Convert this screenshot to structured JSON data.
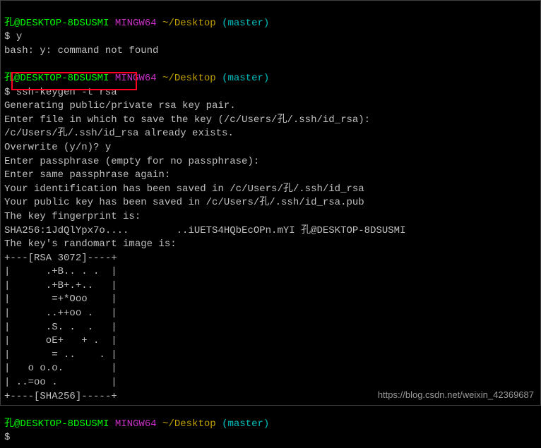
{
  "prompt1": {
    "user": "孔@DESKTOP-8DSUSMI",
    "shell": "MINGW64",
    "path": "~/Desktop",
    "branch": "(master)"
  },
  "line_prompt_dollar": "$",
  "cmd1": "y",
  "err1": "bash: y: command not found",
  "cmd2": "ssh-keygen -t rsa",
  "gen1": "Generating public/private rsa key pair.",
  "gen2": "Enter file in which to save the key (/c/Users/孔/.ssh/id_rsa):",
  "gen3": "/c/Users/孔/.ssh/id_rsa already exists.",
  "gen4": "Overwrite (y/n)? y",
  "gen5": "Enter passphrase (empty for no passphrase):",
  "gen6": "Enter same passphrase again:",
  "gen7": "Your identification has been saved in /c/Users/孔/.ssh/id_rsa",
  "gen8": "Your public key has been saved in /c/Users/孔/.ssh/id_rsa.pub",
  "gen9": "The key fingerprint is:",
  "gen10": "SHA256:1JdQlYpx7o....        ..iUETS4HQbEcOPn.mYI 孔@DESKTOP-8DSUSMI",
  "gen11": "The key's randomart image is:",
  "art1": "+---[RSA 3072]----+",
  "art2": "|      .+B.. . .  |",
  "art3": "|      .+B+.+..   |",
  "art4": "|       =+*Ooo    |",
  "art5": "|      ..++oo .   |",
  "art6": "|      .S. .  .   |",
  "art7": "|      oE+   + .  |",
  "art8": "|       = ..    . |",
  "art9": "|   o o.o.        |",
  "art10": "| ..=oo .         |",
  "art11": "+----[SHA256]-----+",
  "watermark": "https://blog.csdn.net/weixin_42369687"
}
